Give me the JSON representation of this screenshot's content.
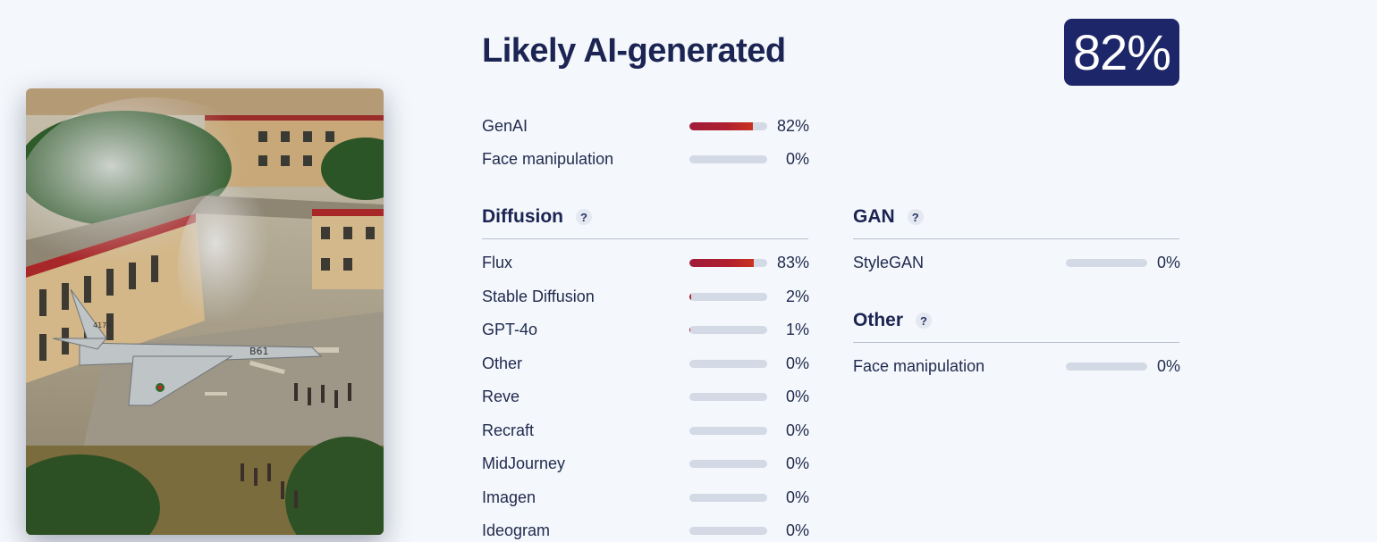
{
  "verdict": "Likely AI-generated",
  "score": "82%",
  "image_alt": "Aerial view of a crashed military jet amid a damaged school building with onlookers",
  "summary": [
    {
      "label": "GenAI",
      "value": 82,
      "pct": "82%"
    },
    {
      "label": "Face manipulation",
      "value": 0,
      "pct": "0%"
    }
  ],
  "diffusion": {
    "title": "Diffusion",
    "help": "?",
    "items": [
      {
        "label": "Flux",
        "value": 83,
        "pct": "83%"
      },
      {
        "label": "Stable Diffusion",
        "value": 2,
        "pct": "2%"
      },
      {
        "label": "GPT-4o",
        "value": 1,
        "pct": "1%"
      },
      {
        "label": "Other",
        "value": 0,
        "pct": "0%"
      },
      {
        "label": "Reve",
        "value": 0,
        "pct": "0%"
      },
      {
        "label": "Recraft",
        "value": 0,
        "pct": "0%"
      },
      {
        "label": "MidJourney",
        "value": 0,
        "pct": "0%"
      },
      {
        "label": "Imagen",
        "value": 0,
        "pct": "0%"
      },
      {
        "label": "Ideogram",
        "value": 0,
        "pct": "0%"
      }
    ]
  },
  "gan": {
    "title": "GAN",
    "help": "?",
    "items": [
      {
        "label": "StyleGAN",
        "value": 0,
        "pct": "0%"
      }
    ]
  },
  "other": {
    "title": "Other",
    "help": "?",
    "items": [
      {
        "label": "Face manipulation",
        "value": 0,
        "pct": "0%"
      }
    ]
  },
  "colors": {
    "badge_bg": "#1c2668",
    "bar_fill": "#b0202f",
    "bar_track": "#d3d9e5",
    "page_bg": "#f4f7fb"
  }
}
